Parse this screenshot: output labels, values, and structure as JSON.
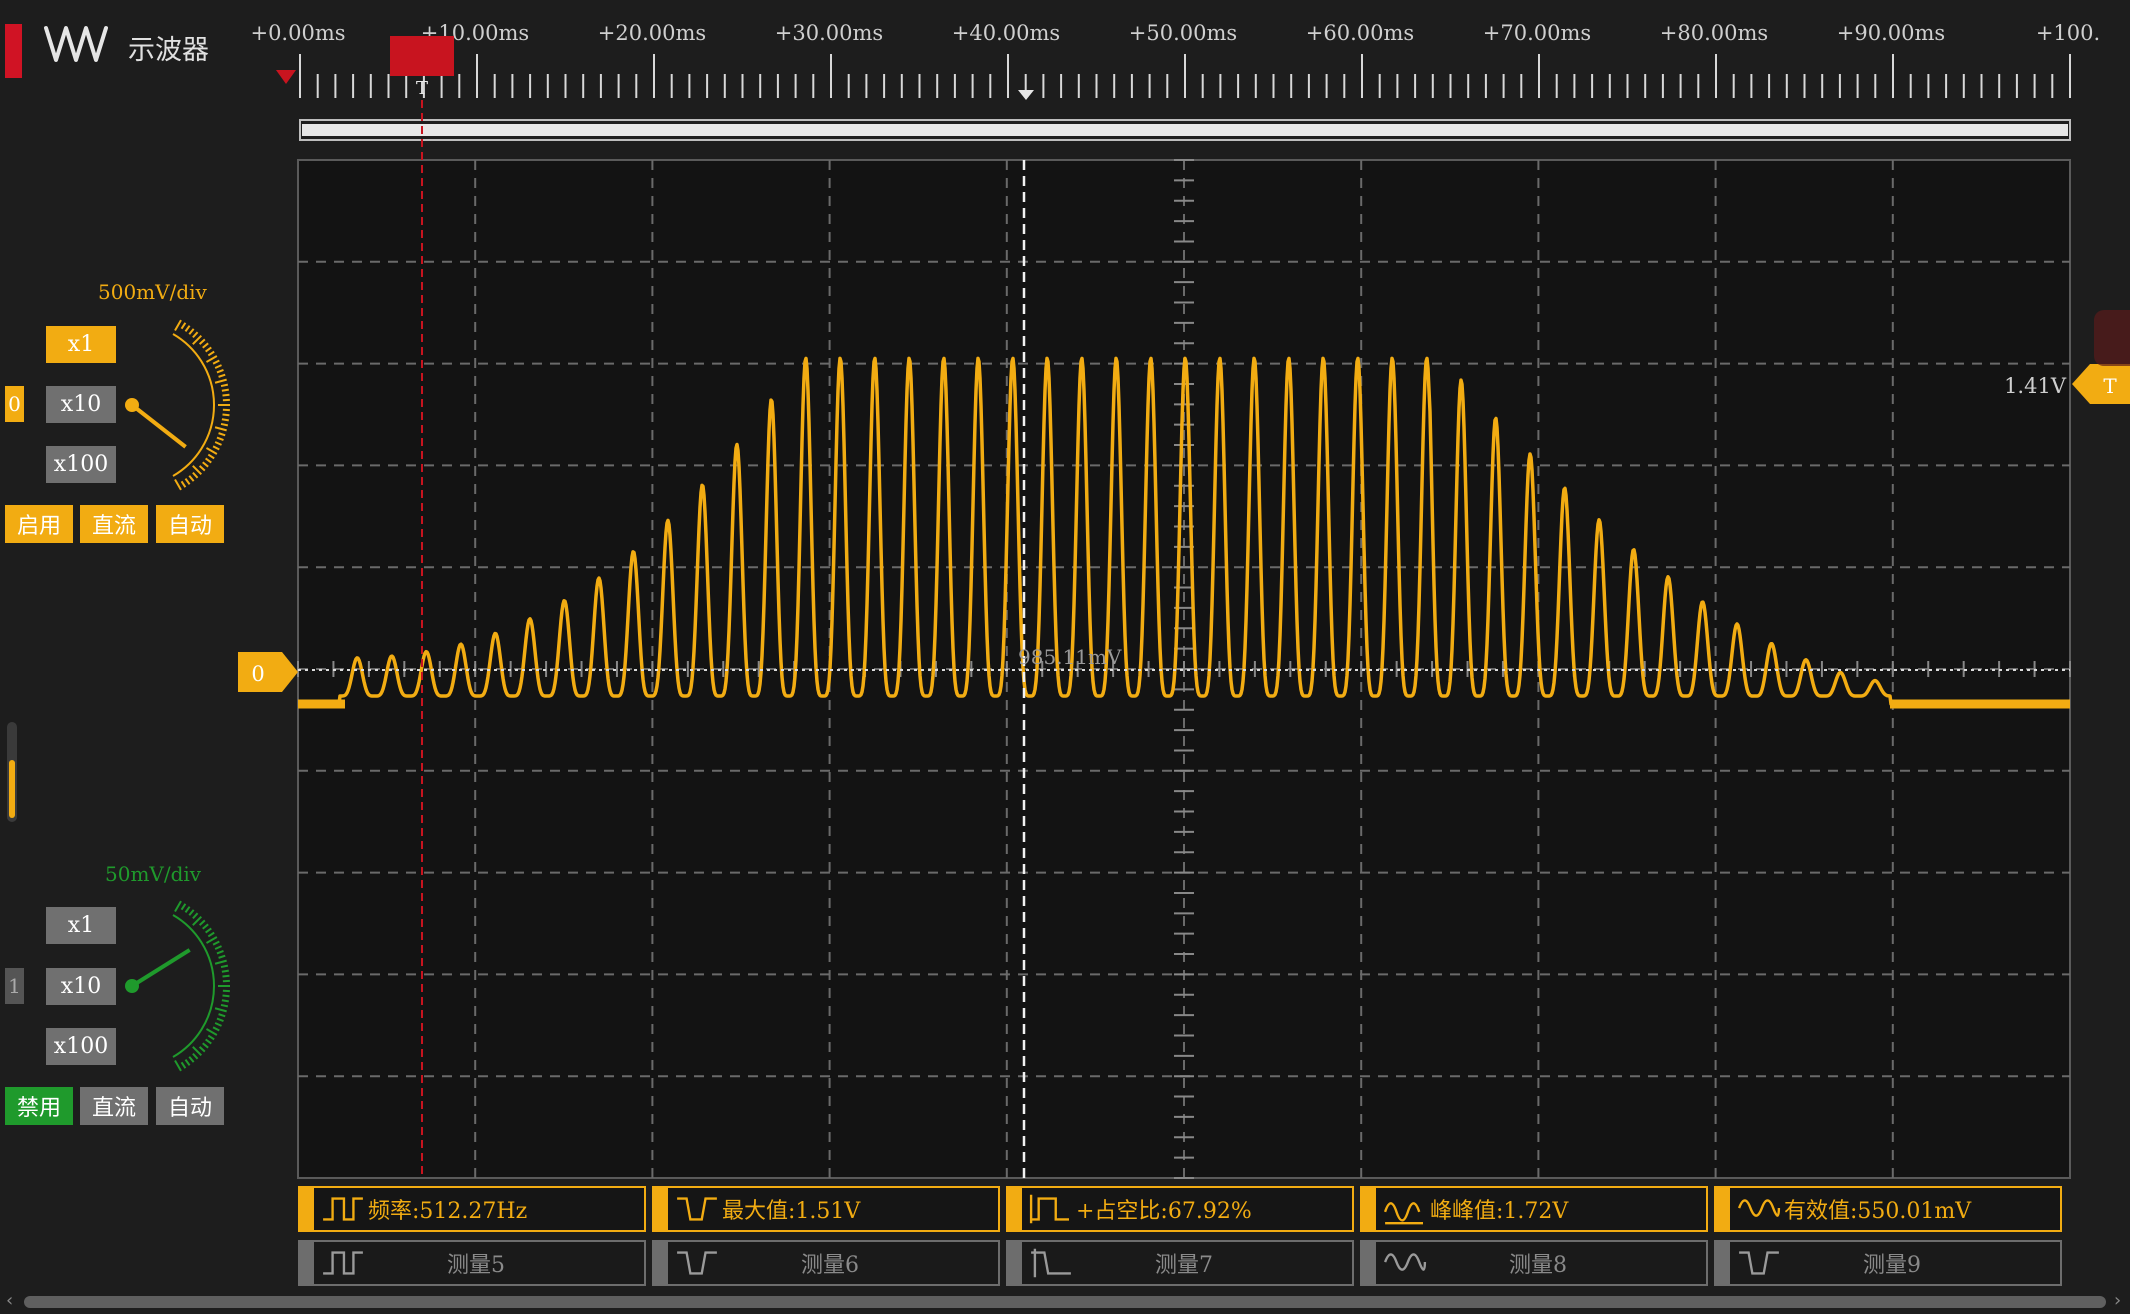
{
  "app": {
    "title": "示波器"
  },
  "timebase": {
    "labels": [
      "+0.00ms",
      "+10.00ms",
      "+20.00ms",
      "+30.00ms",
      "+40.00ms",
      "+50.00ms",
      "+60.00ms",
      "+70.00ms",
      "+80.00ms",
      "+90.00ms",
      "+100."
    ],
    "trigger_marker": "T"
  },
  "channels": [
    {
      "scale": "500mV/div",
      "index_label": "0",
      "probe": [
        "x1",
        "x10",
        "x100"
      ],
      "selected_probe": "x1",
      "controls": {
        "enable": "启用",
        "coupling": "直流",
        "mode": "自动"
      },
      "color": "#f2ac12",
      "dial_color": "#f2ac12"
    },
    {
      "scale": "50mV/div",
      "index_label": "1",
      "probe": [
        "x1",
        "x10",
        "x100"
      ],
      "selected_probe": "x10",
      "controls": {
        "enable": "禁用",
        "coupling": "直流",
        "mode": "自动"
      },
      "color": "#1f9a2c",
      "dial_color": "#1f9a2c"
    }
  ],
  "screen": {
    "trigger_level_label": "1.41V",
    "trigger_tag": "T",
    "cursor_readout": "985.11mV",
    "ground_marker": "0",
    "trace_color": "#f2ac12"
  },
  "measurements": {
    "active": [
      {
        "label": "频率:512.27Hz",
        "icon": "rising-pulse-icon"
      },
      {
        "label": "最大值:1.51V",
        "icon": "max-pulse-icon"
      },
      {
        "label": "+占空比:67.92%",
        "icon": "duty-cycle-icon"
      },
      {
        "label": "峰峰值:1.72V",
        "icon": "peak-to-peak-icon"
      },
      {
        "label": "有效值:550.01mV",
        "icon": "rms-wave-icon"
      }
    ],
    "inactive": [
      {
        "label": "测量5",
        "icon": "rising-pulse-icon"
      },
      {
        "label": "测量6",
        "icon": "max-pulse-icon"
      },
      {
        "label": "测量7",
        "icon": "falling-edge-icon"
      },
      {
        "label": "测量8",
        "icon": "rms-wave-icon"
      },
      {
        "label": "测量9",
        "icon": "max-pulse-icon"
      }
    ]
  }
}
